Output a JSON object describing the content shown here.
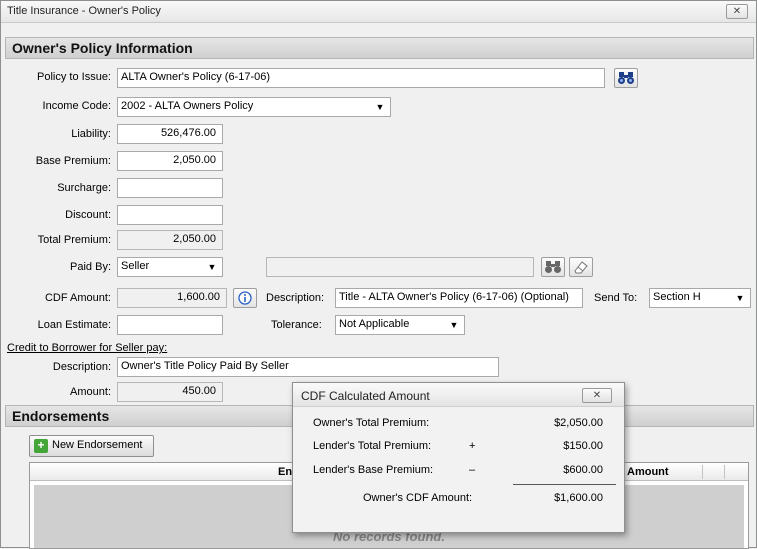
{
  "window": {
    "title": "Title Insurance - Owner's Policy",
    "close": "✕"
  },
  "policy_section": {
    "header": "Owner's Policy Information",
    "policy_to_issue": {
      "label": "Policy to Issue:",
      "value": "ALTA Owner's Policy (6-17-06)"
    },
    "income_code": {
      "label": "Income Code:",
      "value": "2002  - ALTA Owners Policy"
    },
    "liability": {
      "label": "Liability:",
      "value": "526,476.00"
    },
    "base_premium": {
      "label": "Base Premium:",
      "value": "2,050.00"
    },
    "surcharge": {
      "label": "Surcharge:",
      "value": ""
    },
    "discount": {
      "label": "Discount:",
      "value": ""
    },
    "total_premium": {
      "label": "Total Premium:",
      "value": "2,050.00"
    },
    "paid_by": {
      "label": "Paid By:",
      "value": "Seller",
      "payee_value": ""
    },
    "cdf_amount": {
      "label": "CDF Amount:",
      "value": "1,600.00"
    },
    "description": {
      "label": "Description:",
      "value": "Title - ALTA Owner's Policy (6-17-06) (Optional)"
    },
    "send_to": {
      "label": "Send To:",
      "value": "Section H"
    },
    "loan_estimate": {
      "label": "Loan Estimate:",
      "value": ""
    },
    "tolerance": {
      "label": "Tolerance:",
      "value": "Not Applicable"
    },
    "credit_link": "Credit to Borrower for Seller pay:",
    "credit_description": {
      "label": "Description:",
      "value": "Owner's Title Policy Paid By Seller"
    },
    "credit_amount": {
      "label": "Amount:",
      "value": "450.00"
    }
  },
  "endorsements": {
    "header": "Endorsements",
    "new_button": "New Endorsement",
    "columns": [
      "Endo",
      "Amount"
    ],
    "empty_text": "No records found."
  },
  "popup": {
    "title": "CDF Calculated Amount",
    "close": "✕",
    "rows": [
      {
        "label": "Owner's Total Premium:",
        "op": "",
        "value": "$2,050.00"
      },
      {
        "label": "Lender's Total Premium:",
        "op": "+",
        "value": "$150.00"
      },
      {
        "label": "Lender's Base Premium:",
        "op": "–",
        "value": "$600.00"
      }
    ],
    "total_label": "Owner's CDF Amount:",
    "total_value": "$1,600.00"
  },
  "icons": {
    "search": "binoculars-icon",
    "eraser": "eraser-icon",
    "info": "info-icon",
    "dropdown": "▼"
  }
}
